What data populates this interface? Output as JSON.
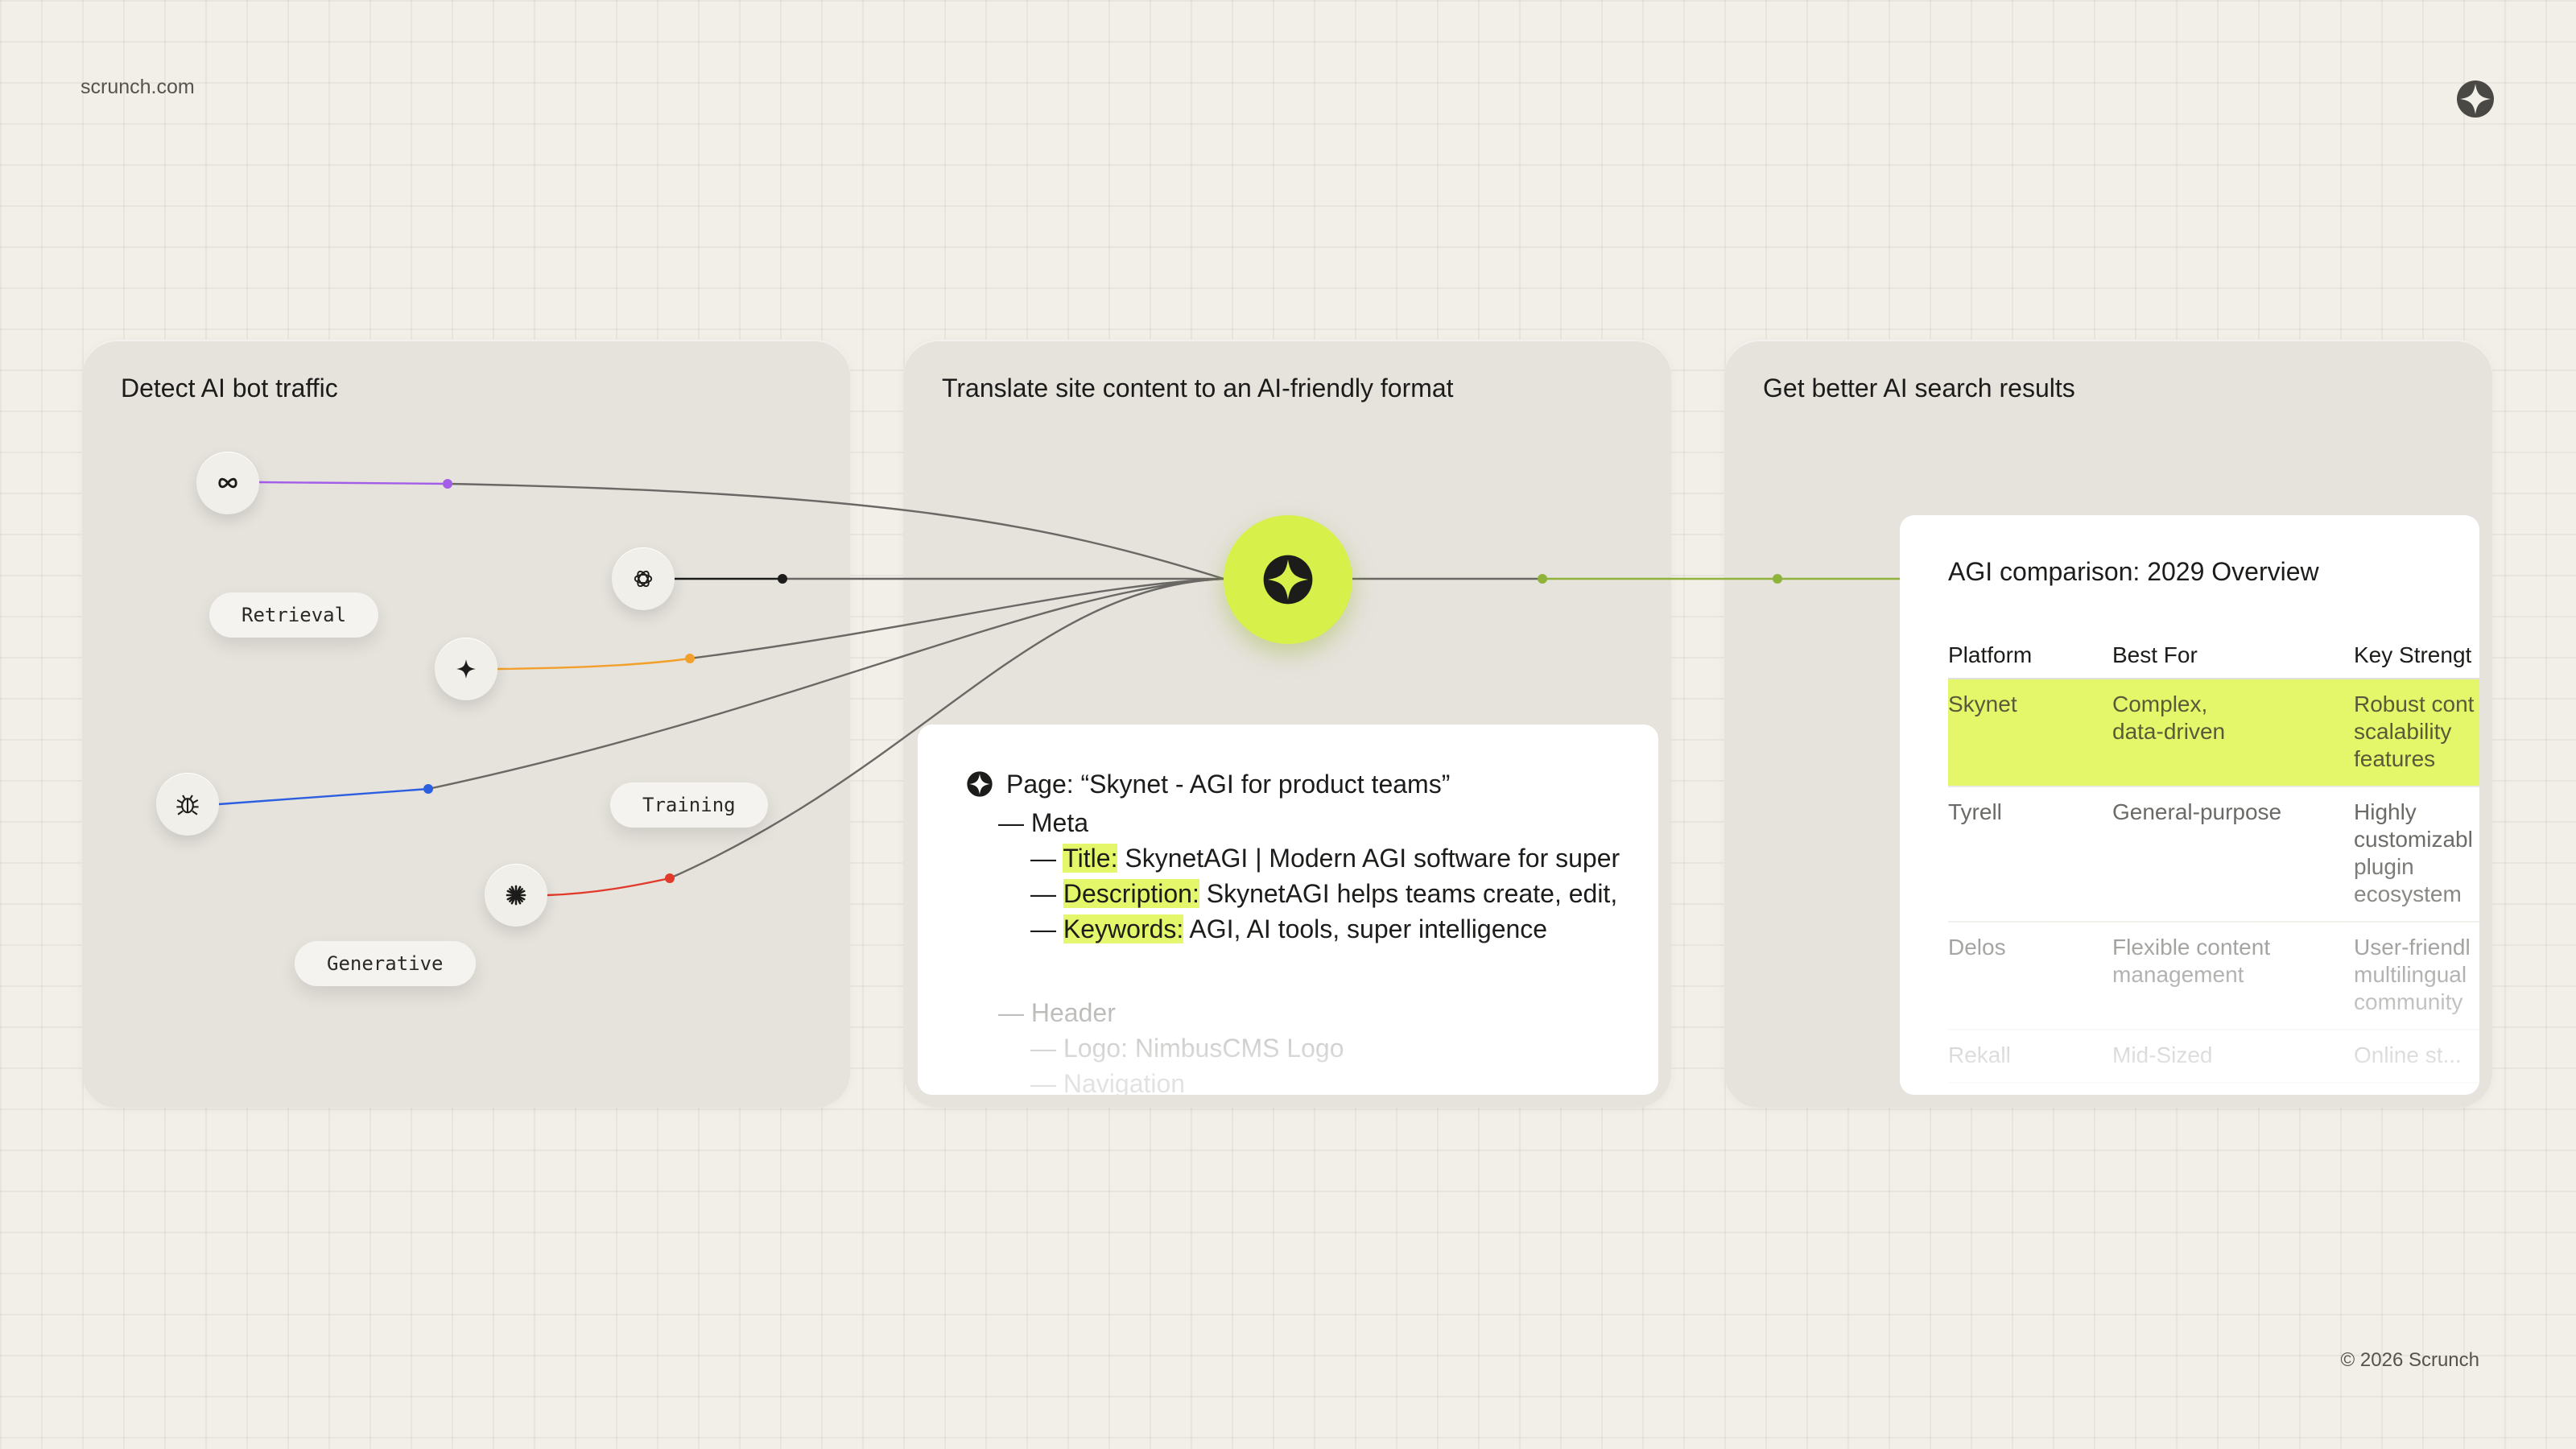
{
  "brand": "scrunch.com",
  "copyright": "© 2026 Scrunch",
  "colors": {
    "accent": "#d8f14a",
    "background": "#f2efe9",
    "panel": "#e6e3dd",
    "highlight": "#e4f76a"
  },
  "panels": [
    {
      "title": "Detect AI bot traffic"
    },
    {
      "title": "Translate site content to an AI-friendly format"
    },
    {
      "title": "Get better AI search results"
    }
  ],
  "bots": [
    {
      "icon": "meta-infinity-icon",
      "line_color": "#a35ee8"
    },
    {
      "icon": "openai-knot-icon",
      "line_color": "#1c1c1a"
    },
    {
      "icon": "four-point-star-icon",
      "line_color": "#f2a02b"
    },
    {
      "icon": "bug-icon",
      "line_color": "#2c5ee0"
    },
    {
      "icon": "asterisk-burst-icon",
      "line_color": "#e23a2a"
    }
  ],
  "tags": {
    "retrieval": "Retrieval",
    "training": "Training",
    "generative": "Generative"
  },
  "hub": {
    "icon": "scrunch-logo-icon"
  },
  "doc": {
    "page_line": "Page: “Skynet - AGI for product teams”",
    "meta": "— Meta",
    "title_dash": "— ",
    "title_label": "Title:",
    "title_value": " SkynetAGI | Modern AGI software for super",
    "desc_dash": "— ",
    "desc_label": "Description:",
    "desc_value": " SkynetAGI helps teams create, edit,",
    "kw_dash": "— ",
    "kw_label": "Keywords:",
    "kw_value": " AGI, AI tools, super intelligence",
    "header": "— Header",
    "logo": "— Logo: NimbusCMS Logo",
    "navigation": "— Navigation"
  },
  "result": {
    "title": "AGI comparison: 2029 Overview",
    "columns": [
      "Platform",
      "Best For",
      "Key Strengt"
    ],
    "rows": [
      {
        "platform": "Skynet",
        "best_for": [
          "Complex,",
          "data-driven"
        ],
        "strength": [
          "Robust cont",
          "scalability",
          "features"
        ],
        "highlighted": true
      },
      {
        "platform": "Tyrell",
        "best_for": [
          "General-purpose"
        ],
        "strength": [
          "Highly",
          "customizabl",
          "plugin",
          "ecosystem"
        ],
        "highlighted": false
      },
      {
        "platform": "Delos",
        "best_for": [
          "Flexible content",
          "management"
        ],
        "strength": [
          "User-friendl",
          "multilingual",
          "community"
        ],
        "highlighted": false
      },
      {
        "platform": "Rekall",
        "best_for": [
          "Mid-Sized"
        ],
        "strength": [
          "Online st..."
        ],
        "highlighted": false
      }
    ]
  }
}
